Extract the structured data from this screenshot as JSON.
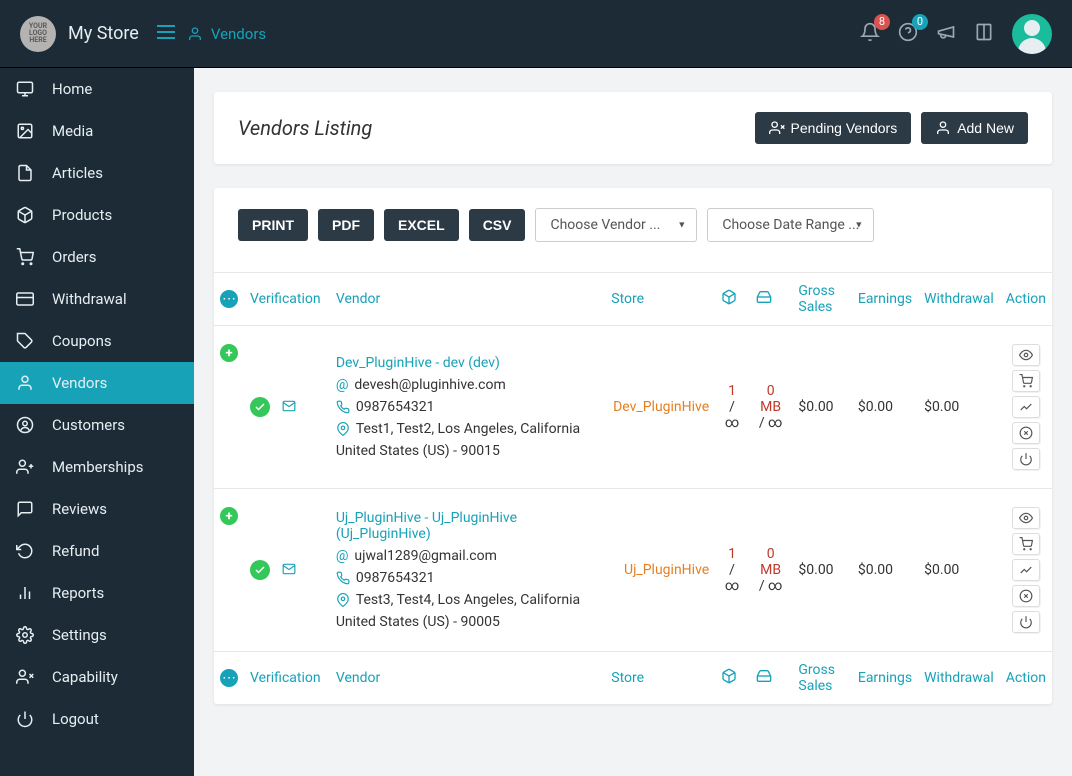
{
  "topbar": {
    "logo_text": "YOUR LOGO HERE",
    "store_name": "My Store",
    "breadcrumb": "Vendors",
    "notif_count": "8",
    "help_count": "0"
  },
  "sidebar": {
    "items": [
      {
        "label": "Home",
        "icon": "monitor"
      },
      {
        "label": "Media",
        "icon": "picture"
      },
      {
        "label": "Articles",
        "icon": "document"
      },
      {
        "label": "Products",
        "icon": "cube"
      },
      {
        "label": "Orders",
        "icon": "cart"
      },
      {
        "label": "Withdrawal",
        "icon": "card"
      },
      {
        "label": "Coupons",
        "icon": "tag"
      },
      {
        "label": "Vendors",
        "icon": "user",
        "active": true
      },
      {
        "label": "Customers",
        "icon": "user-circle"
      },
      {
        "label": "Memberships",
        "icon": "users-plus"
      },
      {
        "label": "Reviews",
        "icon": "chat"
      },
      {
        "label": "Refund",
        "icon": "undo"
      },
      {
        "label": "Reports",
        "icon": "chart"
      },
      {
        "label": "Settings",
        "icon": "gears"
      },
      {
        "label": "Capability",
        "icon": "user-x"
      },
      {
        "label": "Logout",
        "icon": "power"
      }
    ]
  },
  "header": {
    "title": "Vendors Listing",
    "pending_btn": "Pending Vendors",
    "add_btn": "Add New"
  },
  "toolbar": {
    "print": "PRINT",
    "pdf": "PDF",
    "excel": "EXCEL",
    "csv": "CSV",
    "vendor_select": "Choose Vendor ...",
    "date_select": "Choose Date Range ..."
  },
  "columns": {
    "verification": "Verification",
    "vendor": "Vendor",
    "store": "Store",
    "gross": "Gross Sales",
    "earnings": "Earnings",
    "withdrawal": "Withdrawal",
    "action": "Action"
  },
  "rows": [
    {
      "name": "Dev_PluginHive - dev (dev)",
      "email": "devesh@pluginhive.com",
      "phone": "0987654321",
      "address1": "Test1, Test2, Los Angeles, California",
      "address2": "United States (US) - 90015",
      "store": "Dev_PluginHive",
      "limit1_top": "1 /",
      "limit1_bot": "∞",
      "limit2_top": "0 MB",
      "limit2_bot": "/ ∞",
      "gross": "$0.00",
      "earn": "$0.00",
      "withdrawal": "$0.00"
    },
    {
      "name": "Uj_PluginHive - Uj_PluginHive (Uj_PluginHive)",
      "email": "ujwal1289@gmail.com",
      "phone": "0987654321",
      "address1": "Test3, Test4, Los Angeles, California",
      "address2": "United States (US) - 90005",
      "store": "Uj_PluginHive",
      "limit1_top": "1 /",
      "limit1_bot": "∞",
      "limit2_top": "0 MB",
      "limit2_bot": "/ ∞",
      "gross": "$0.00",
      "earn": "$0.00",
      "withdrawal": "$0.00"
    }
  ]
}
